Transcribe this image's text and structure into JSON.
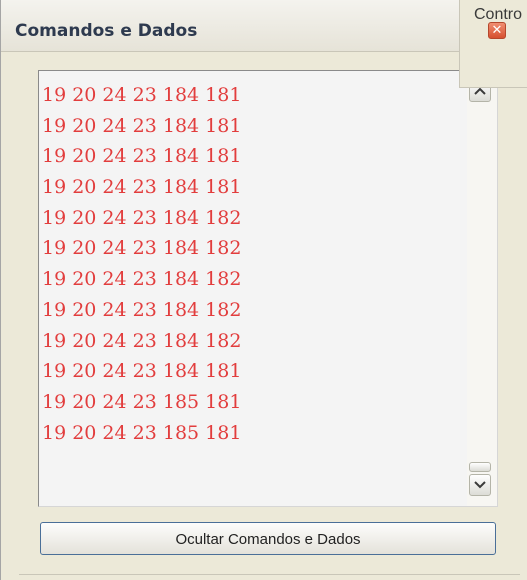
{
  "window": {
    "title": "Comandos e Dados"
  },
  "side_panel": {
    "label": "Contro"
  },
  "list": {
    "items": [
      "19 20 24 23 184 181",
      "19 20 24 23 184 181",
      "19 20 24 23 184 181",
      "19 20 24 23 184 181",
      "19 20 24 23 184 182",
      "19 20 24 23 184 182",
      "19 20 24 23 184 182",
      "19 20 24 23 184 182",
      "19 20 24 23 184 182",
      "19 20 24 23 184 181",
      "19 20 24 23 185 181",
      "19 20 24 23 185 181"
    ],
    "text_color": "#e23d3d"
  },
  "buttons": {
    "toggle_label": "Ocultar Comandos e Dados"
  },
  "icons": {
    "close": "close-icon",
    "scroll_up": "chevron-up-icon",
    "scroll_down": "chevron-down-icon"
  }
}
